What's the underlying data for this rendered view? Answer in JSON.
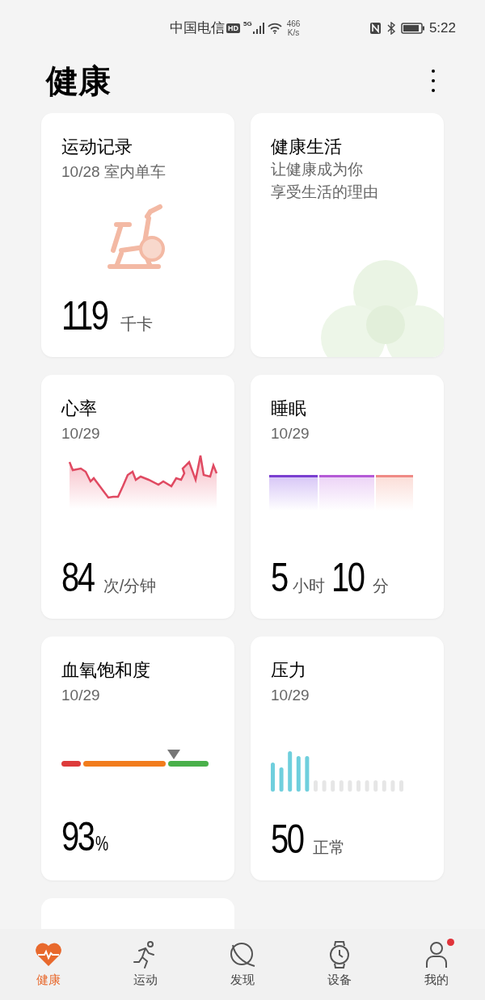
{
  "status_bar": {
    "carrier": "中国电信",
    "hd": "HD",
    "network": "5G",
    "speed": "466",
    "speed_unit": "K/s",
    "time": "5:22"
  },
  "title": "健康",
  "cards": [
    {
      "kind": "workout",
      "title": "运动记录",
      "subtitle": "10/28 室内单车",
      "value_parts": [
        {
          "text": "119",
          "kind": "number"
        },
        {
          "text": "千卡",
          "kind": "unit"
        }
      ]
    },
    {
      "kind": "wellness",
      "title": "健康生活",
      "lines": [
        "让健康成为你",
        "享受生活的理由"
      ]
    },
    {
      "kind": "heart",
      "title": "心率",
      "subtitle": "10/29",
      "value_parts": [
        {
          "text": "84",
          "kind": "number"
        },
        {
          "text": "次/分钟",
          "kind": "unit"
        }
      ]
    },
    {
      "kind": "sleep",
      "title": "睡眠",
      "subtitle": "10/29",
      "value_parts": [
        {
          "text": "5",
          "kind": "number"
        },
        {
          "text": "小时",
          "kind": "unit"
        },
        {
          "text": "10",
          "kind": "number"
        },
        {
          "text": "分",
          "kind": "unit"
        }
      ]
    },
    {
      "kind": "spo2",
      "title": "血氧饱和度",
      "subtitle": "10/29",
      "value_parts": [
        {
          "text": "93",
          "kind": "number"
        },
        {
          "text": "%",
          "kind": "small"
        }
      ]
    },
    {
      "kind": "stress",
      "title": "压力",
      "subtitle": "10/29",
      "value_parts": [
        {
          "text": "50",
          "kind": "number"
        },
        {
          "text": "正常",
          "kind": "unit"
        }
      ]
    },
    {
      "kind": "partial"
    }
  ],
  "nav": [
    {
      "label": "健康",
      "selected": true,
      "badge": false
    },
    {
      "label": "运动",
      "selected": false,
      "badge": false
    },
    {
      "label": "发现",
      "selected": false,
      "badge": false
    },
    {
      "label": "设备",
      "selected": false,
      "badge": false
    },
    {
      "label": "我的",
      "selected": false,
      "badge": true
    }
  ]
}
